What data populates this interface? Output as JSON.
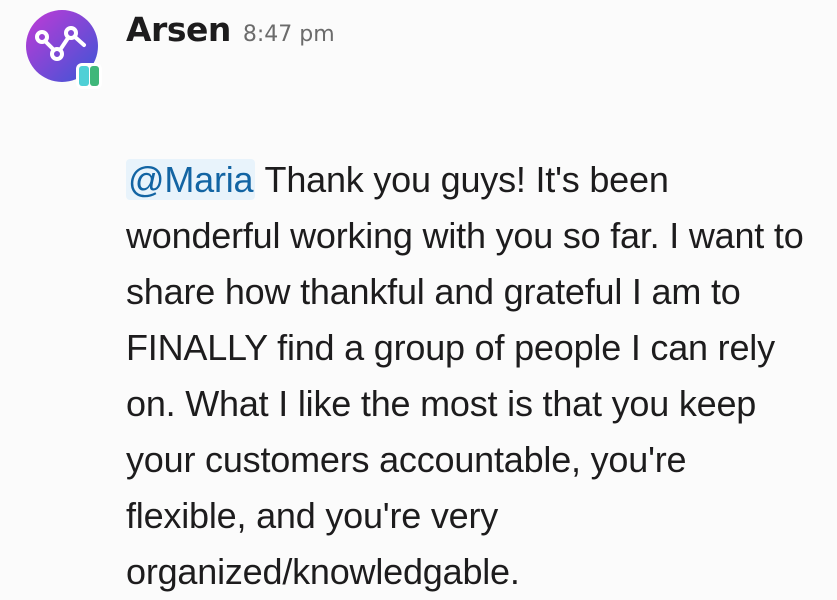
{
  "message": {
    "author": "Arsen",
    "timestamp": "8:47 pm",
    "mention": "@Maria",
    "body": " Thank you guys! It's been wonderful working with you so far. I want to share how thankful and grateful I am to FINALLY find a group of people I can rely on. What I like the most is that you keep your customers accountable, you're flexible, and you're very organized/knowledgable."
  },
  "avatar": {
    "icon": "network-graph-logo",
    "gradient_start": "#c13ad6",
    "gradient_end": "#3a56d6",
    "badge_color_left": "#4fd0d6",
    "badge_color_right": "#3fb77a"
  }
}
